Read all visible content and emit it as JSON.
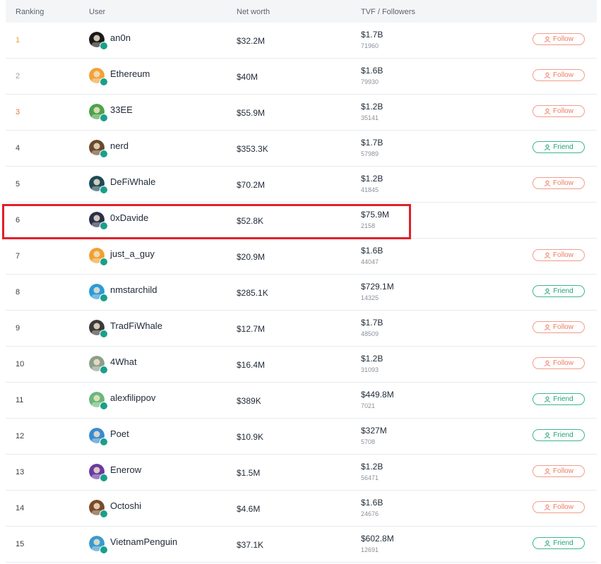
{
  "header": {
    "ranking": "Ranking",
    "user": "User",
    "net_worth": "Net worth",
    "tvf_followers": "TVF / Followers"
  },
  "colors": {
    "follow": "#ef7b62",
    "friend": "#21a374",
    "highlight": "#e0202a",
    "rank_gold": "#e9a23b",
    "rank_bronze": "#e07a3f"
  },
  "rows": [
    {
      "rank": "1",
      "user": "an0n",
      "net_worth": "$32.2M",
      "tvf": "$1.7B",
      "followers": "71960",
      "action": "Follow",
      "avatar_color": "#1a1a1a"
    },
    {
      "rank": "2",
      "user": "Ethereum",
      "net_worth": "$40M",
      "tvf": "$1.6B",
      "followers": "79930",
      "action": "Follow",
      "avatar_color": "#f0a23a"
    },
    {
      "rank": "3",
      "user": "33EE",
      "net_worth": "$55.9M",
      "tvf": "$1.2B",
      "followers": "35141",
      "action": "Follow",
      "avatar_color": "#4aa34a"
    },
    {
      "rank": "4",
      "user": "nerd",
      "net_worth": "$353.3K",
      "tvf": "$1.7B",
      "followers": "57989",
      "action": "Friend",
      "avatar_color": "#6b4a2b"
    },
    {
      "rank": "5",
      "user": "DeFiWhale",
      "net_worth": "$70.2M",
      "tvf": "$1.2B",
      "followers": "41845",
      "action": "Follow",
      "avatar_color": "#1f4a5a"
    },
    {
      "rank": "6",
      "user": "0xDavide",
      "net_worth": "$52.8K",
      "tvf": "$75.9M",
      "followers": "2158",
      "action": "",
      "avatar_color": "#2a2f4a"
    },
    {
      "rank": "7",
      "user": "just_a_guy",
      "net_worth": "$20.9M",
      "tvf": "$1.6B",
      "followers": "44047",
      "action": "Follow",
      "avatar_color": "#f0a030"
    },
    {
      "rank": "8",
      "user": "nmstarchild",
      "net_worth": "$285.1K",
      "tvf": "$729.1M",
      "followers": "14325",
      "action": "Friend",
      "avatar_color": "#2a9ad8"
    },
    {
      "rank": "9",
      "user": "TradFiWhale",
      "net_worth": "$12.7M",
      "tvf": "$1.7B",
      "followers": "48509",
      "action": "Follow",
      "avatar_color": "#3a3a3a"
    },
    {
      "rank": "10",
      "user": "4What",
      "net_worth": "$16.4M",
      "tvf": "$1.2B",
      "followers": "31093",
      "action": "Follow",
      "avatar_color": "#8aa08a"
    },
    {
      "rank": "11",
      "user": "alexfilippov",
      "net_worth": "$389K",
      "tvf": "$449.8M",
      "followers": "7021",
      "action": "Friend",
      "avatar_color": "#6ab87a"
    },
    {
      "rank": "12",
      "user": "Poet",
      "net_worth": "$10.9K",
      "tvf": "$327M",
      "followers": "5708",
      "action": "Friend",
      "avatar_color": "#3a8ad0"
    },
    {
      "rank": "13",
      "user": "Enerow",
      "net_worth": "$1.5M",
      "tvf": "$1.2B",
      "followers": "56471",
      "action": "Follow",
      "avatar_color": "#6a3aa0"
    },
    {
      "rank": "14",
      "user": "Octoshi",
      "net_worth": "$4.6M",
      "tvf": "$1.6B",
      "followers": "24676",
      "action": "Follow",
      "avatar_color": "#7a4a2a"
    },
    {
      "rank": "15",
      "user": "VietnamPenguin",
      "net_worth": "$37.1K",
      "tvf": "$602.8M",
      "followers": "12691",
      "action": "Friend",
      "avatar_color": "#3a9ad0"
    }
  ]
}
